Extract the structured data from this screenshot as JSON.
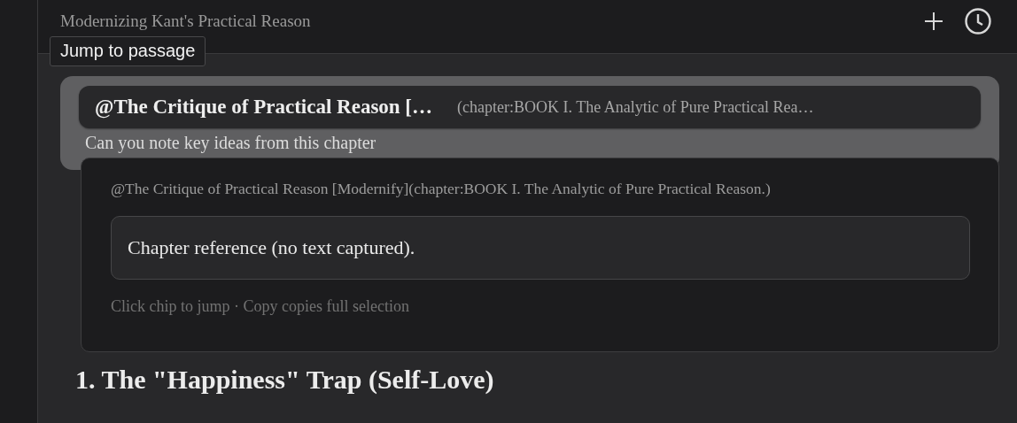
{
  "header": {
    "title": "Modernizing Kant's Practical Reason"
  },
  "tooltip": {
    "text": "Jump to passage"
  },
  "message": {
    "chip": {
      "title": "@The Critique of Practical Reason […",
      "detail": "(chapter:BOOK I. The Analytic of Pure Practical Rea…"
    },
    "text": "Can you note key ideas from this chapter"
  },
  "popover": {
    "reference": "@The Critique of Practical Reason [Modernify](chapter:BOOK I. The Analytic of Pure Practical Reason.)",
    "quote": "Chapter reference (no text captured).",
    "hint": "Click chip to jump · Copy copies full selection"
  },
  "heading": "1. The \"Happiness\" Trap (Self-Love)"
}
